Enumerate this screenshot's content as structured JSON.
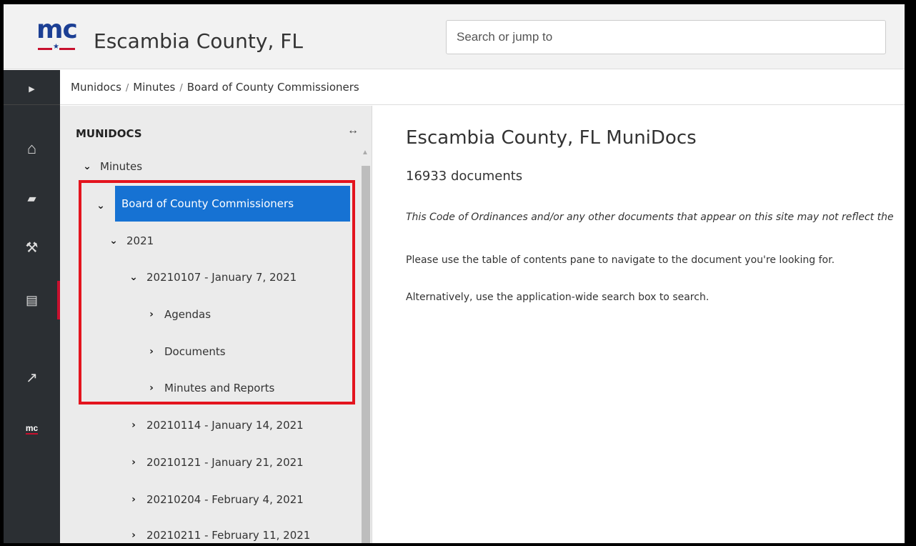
{
  "header": {
    "logo_text": "mc",
    "site_title": "Escambia County, FL",
    "search_placeholder": "Search or jump to"
  },
  "rail": {
    "items": [
      {
        "icon": "chevron-right-icon",
        "glyph": "▶"
      },
      {
        "icon": "home-icon",
        "glyph": "⌂"
      },
      {
        "icon": "book-icon",
        "glyph": "▰"
      },
      {
        "icon": "gavel-icon",
        "glyph": "⚒"
      },
      {
        "icon": "document-icon",
        "glyph": "▤"
      },
      {
        "icon": "external-link-icon",
        "glyph": "↗"
      },
      {
        "icon": "mc-logo-icon",
        "glyph": "mc"
      }
    ]
  },
  "breadcrumb": {
    "items": [
      "Munidocs",
      "Minutes",
      "Board of County Commissioners"
    ],
    "separator": "/"
  },
  "sidebar": {
    "title": "MUNIDOCS",
    "collapse_glyph": "↔",
    "tree": [
      {
        "label": "Minutes",
        "chevron": "down"
      },
      {
        "label": "Board of County Commissioners",
        "chevron": "down",
        "selected": true
      },
      {
        "label": "2021",
        "chevron": "down"
      },
      {
        "label": "20210107 - January 7, 2021",
        "chevron": "down"
      },
      {
        "label": "Agendas",
        "chevron": "right"
      },
      {
        "label": "Documents",
        "chevron": "right"
      },
      {
        "label": "Minutes and Reports",
        "chevron": "right"
      },
      {
        "label": "20210114 - January 14, 2021",
        "chevron": "right"
      },
      {
        "label": "20210121 - January 21, 2021",
        "chevron": "right"
      },
      {
        "label": "20210204 - February 4, 2021",
        "chevron": "right"
      },
      {
        "label": "20210211 - February 11, 2021",
        "chevron": "right"
      }
    ]
  },
  "main": {
    "title": "Escambia County, FL MuniDocs",
    "doc_count": "16933 documents",
    "disclaimer": "This Code of Ordinances and/or any other documents that appear on this site may not reflect the",
    "help_1": "Please use the table of contents pane to navigate to the document you're looking for.",
    "help_2": "Alternatively, use the application-wide search box to search."
  },
  "colors": {
    "accent": "#1672d3",
    "brand_blue": "#1c3f94",
    "brand_red": "#c8102e",
    "highlight": "#e3141e"
  }
}
